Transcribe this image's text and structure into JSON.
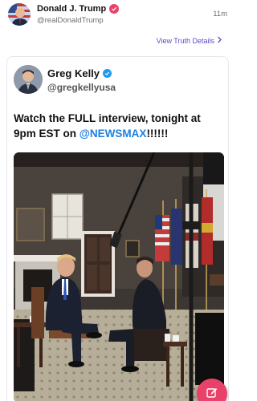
{
  "post": {
    "author_name": "Donald J. Trump",
    "author_handle": "@realDonaldTrump",
    "time": "11m",
    "view_link": "View Truth Details"
  },
  "quoted": {
    "author_name": "Greg Kelly",
    "author_handle": "@gregkellyusa",
    "text_part1": "Watch the FULL interview, tonight at 9pm EST on ",
    "mention": "@NEWSMAX",
    "text_part2": "!!!!!!"
  },
  "colors": {
    "brand_accent": "#e8426a",
    "link": "#5a4bc9",
    "mention": "#1d7fe0",
    "verified_blue": "#1d9bf0"
  },
  "icons": {
    "verified_main": "verified-badge-icon",
    "verified_quoted": "verified-badge-icon",
    "chevron": "chevron-right-icon",
    "compose": "compose-icon"
  }
}
